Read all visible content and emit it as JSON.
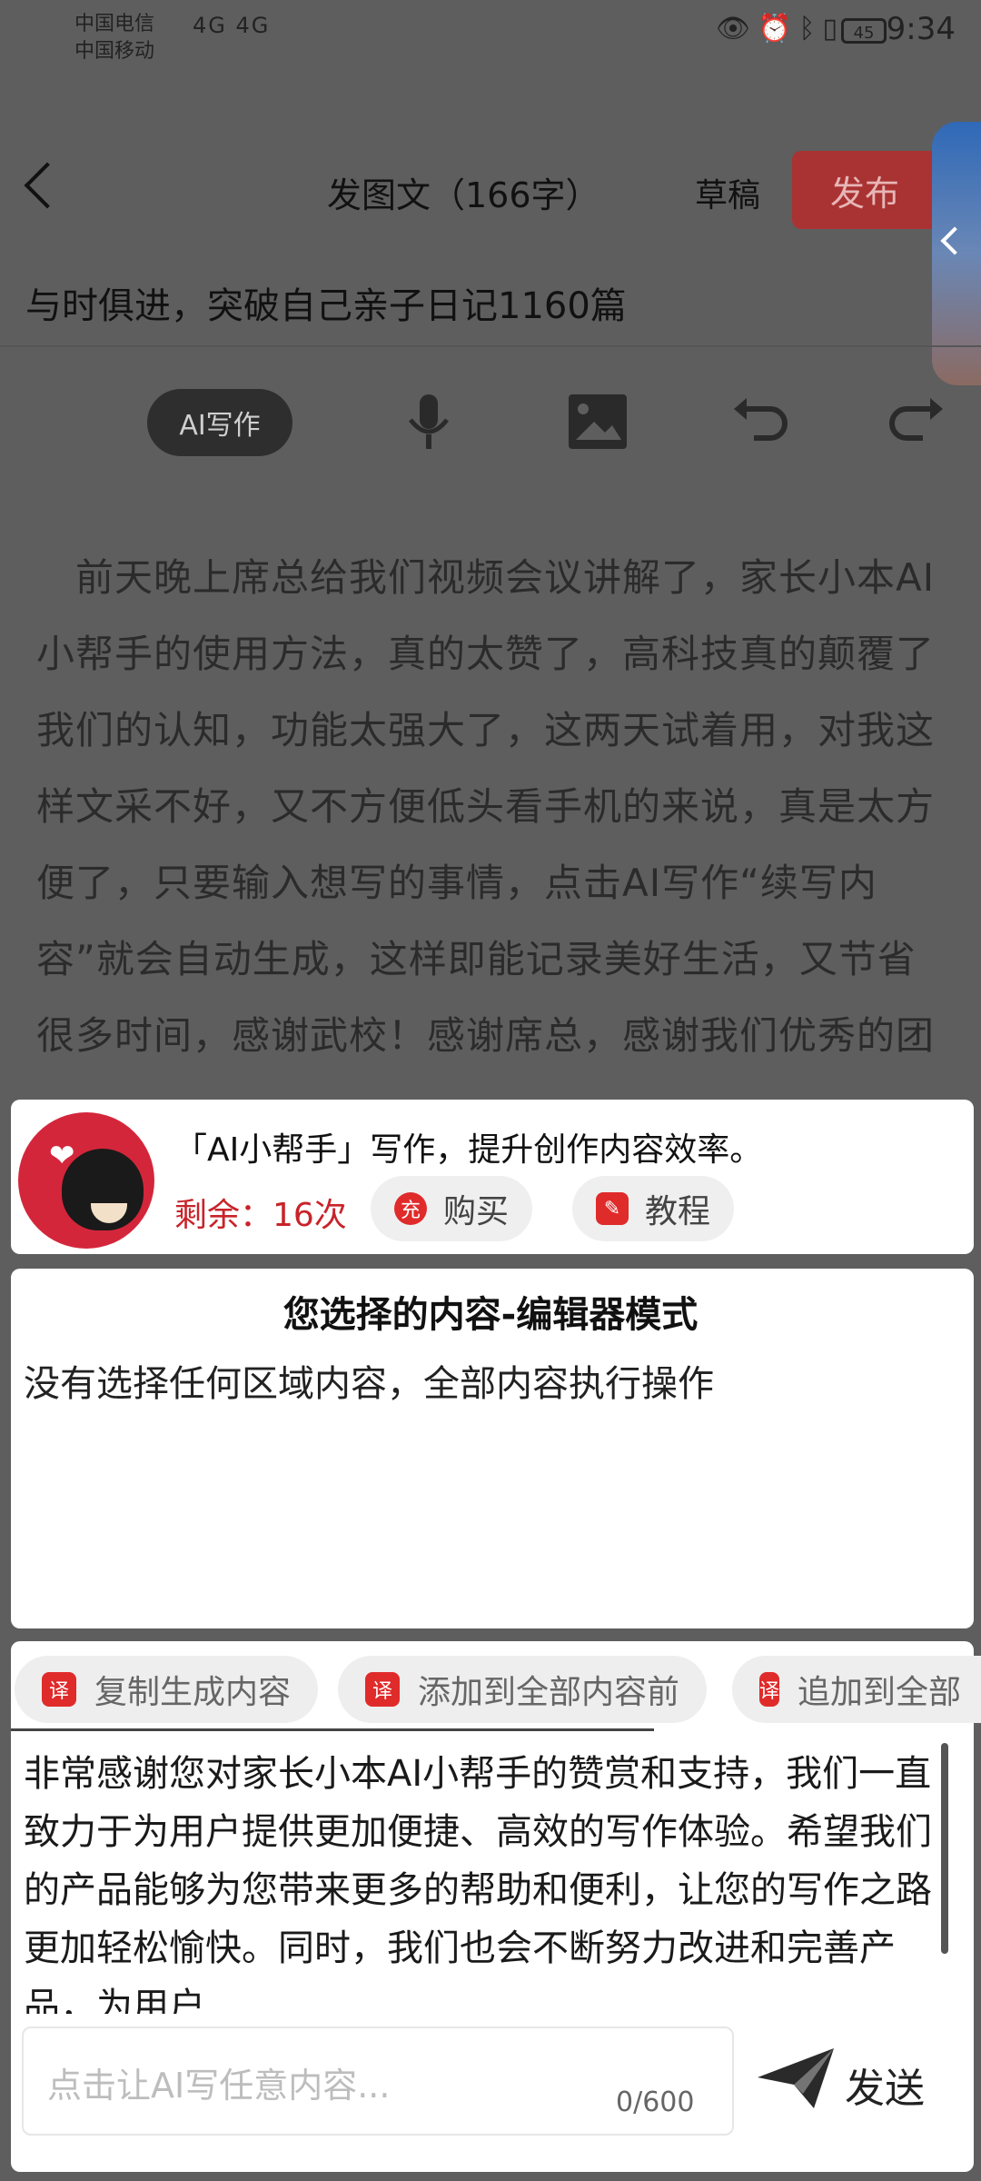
{
  "status": {
    "carrier1": "中国电信",
    "carrier2": "中国移动",
    "network": "4G 4G",
    "battery": "45",
    "time": "9:34"
  },
  "header": {
    "title": "发图文（166字）",
    "draft": "草稿",
    "publish": "发布"
  },
  "doc": {
    "title": "与时俱进，突破自己亲子日记1160篇",
    "body": "　前天晚上席总给我们视频会议讲解了，家长小本AI小帮手的使用方法，真的太赞了，高科技真的颠覆了我们的认知，功能太强大了，这两天试着用，对我这样文采不好，又不方便低头看手机的来说，真是太方便了，只要输入想写的事情，点击AI写作“续写内容”就会自动生成，这样即能记录美好生活，又节省很多时间，感谢武校！感谢席总，感谢我们优秀的团"
  },
  "toolbar": {
    "ai_label": "AI写作"
  },
  "assistant": {
    "title": "「AI小帮手」写作，提升创作内容效率。",
    "remain": "剩余：16次",
    "buy": "购买",
    "buy_icon": "充",
    "tutorial": "教程"
  },
  "selection": {
    "title": "您选择的内容-编辑器模式",
    "text": "没有选择任何区域内容，全部内容执行操作"
  },
  "actions": {
    "copy": "复制生成内容",
    "prepend": "添加到全部内容前",
    "append": "追加到全部",
    "icon_char": "译"
  },
  "result": {
    "text": "非常感谢您对家长小本AI小帮手的赞赏和支持，我们一直致力于为用户提供更加便捷、高效的写作体验。希望我们的产品能够为您带来更多的帮助和便利，让您的写作之路更加轻松愉快。同时，我们也会不断努力改进和完善产品，为用户"
  },
  "input": {
    "placeholder": "点击让AI写任意内容...",
    "counter": "0/600",
    "send": "发送"
  },
  "colors": {
    "publish_bg": "#a93333",
    "accent_red": "#e02b2b",
    "remain_red": "#c8232a"
  }
}
